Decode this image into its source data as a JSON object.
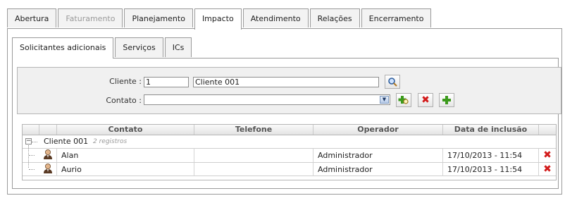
{
  "tabs": [
    {
      "label": "Abertura",
      "state": "normal"
    },
    {
      "label": "Faturamento",
      "state": "disabled"
    },
    {
      "label": "Planejamento",
      "state": "normal"
    },
    {
      "label": "Impacto",
      "state": "active"
    },
    {
      "label": "Atendimento",
      "state": "normal"
    },
    {
      "label": "Relações",
      "state": "normal"
    },
    {
      "label": "Encerramento",
      "state": "normal"
    }
  ],
  "subtabs": [
    {
      "label": "Solicitantes adicionais",
      "state": "active"
    },
    {
      "label": "Serviços",
      "state": "normal"
    },
    {
      "label": "ICs",
      "state": "normal"
    }
  ],
  "form": {
    "cliente_label": "Cliente :",
    "cliente_code": "1",
    "cliente_name": "Cliente 001",
    "contato_label": "Contato :",
    "contato_value": ""
  },
  "grid": {
    "columns": [
      "Contato",
      "Telefone",
      "Operador",
      "Data de inclusão"
    ],
    "group": {
      "label": "Cliente 001",
      "count": "2 registros"
    },
    "rows": [
      {
        "contato": "Alan",
        "telefone": "",
        "operador": "Administrador",
        "data": "17/10/2013 - 11:54"
      },
      {
        "contato": "Aurio",
        "telefone": "",
        "operador": "Administrador",
        "data": "17/10/2013 - 11:54"
      }
    ]
  },
  "colors": {
    "border": "#9a9a9a",
    "filter_bg": "#f0f0f0",
    "delete_red": "#d21a1a",
    "add_green": "#3c9a1c"
  }
}
